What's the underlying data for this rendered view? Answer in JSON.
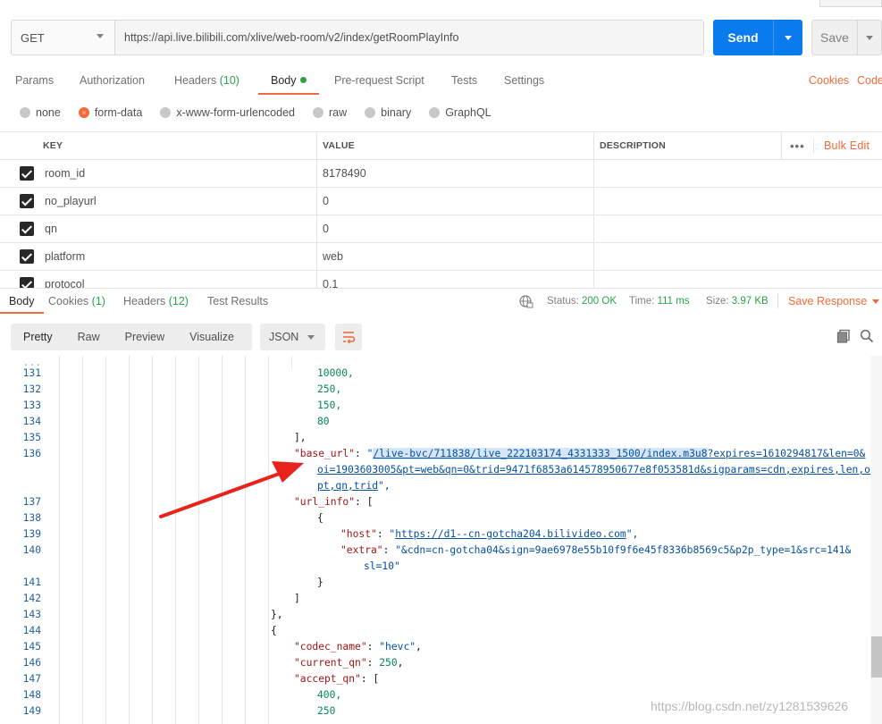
{
  "request": {
    "method": "GET",
    "url": "https://api.live.bilibili.com/xlive/web-room/v2/index/getRoomPlayInfo",
    "send_label": "Send",
    "save_label": "Save"
  },
  "request_tabs": {
    "params": "Params",
    "authorization": "Authorization",
    "headers": "Headers",
    "headers_count": "(10)",
    "body": "Body",
    "prerequest": "Pre-request Script",
    "tests": "Tests",
    "settings": "Settings",
    "cookies": "Cookies",
    "code": "Code"
  },
  "body_types": {
    "none": "none",
    "form_data": "form-data",
    "urlencoded": "x-www-form-urlencoded",
    "raw": "raw",
    "binary": "binary",
    "graphql": "GraphQL"
  },
  "params_table": {
    "col_key": "KEY",
    "col_value": "VALUE",
    "col_description": "DESCRIPTION",
    "more": "•••",
    "bulk_edit": "Bulk Edit",
    "rows": [
      {
        "key": "room_id",
        "value": "8178490"
      },
      {
        "key": "no_playurl",
        "value": "0"
      },
      {
        "key": "qn",
        "value": "0"
      },
      {
        "key": "platform",
        "value": "web"
      },
      {
        "key": "protocol",
        "value": "0,1"
      }
    ]
  },
  "response_tabs": {
    "body": "Body",
    "cookies": "Cookies",
    "cookies_count": "(1)",
    "headers": "Headers",
    "headers_count": "(12)",
    "test_results": "Test Results"
  },
  "response_status": {
    "status_label": "Status:",
    "status_value": "200 OK",
    "time_label": "Time:",
    "time_value": "111 ms",
    "size_label": "Size:",
    "size_value": "3.97 KB",
    "save_response": "Save Response"
  },
  "view_modes": {
    "pretty": "Pretty",
    "raw": "Raw",
    "preview": "Preview",
    "visualize": "Visualize",
    "format": "JSON"
  },
  "code": {
    "line_numbers": [
      "131",
      "132",
      "133",
      "134",
      "135",
      "136",
      "",
      "",
      "137",
      "138",
      "139",
      "140",
      "",
      "141",
      "142",
      "143",
      "144",
      "145",
      "146",
      "147",
      "148",
      "149"
    ],
    "l131": "10000,",
    "l132": "250,",
    "l133": "150,",
    "l134": "80",
    "l135": "],",
    "base_url_key": "\"base_url\"",
    "base_url_path": "/live-bvc/711838/live_222103174_4331333_1500/index.m3u8",
    "base_url_rest1": "?expires=1610294817&len=0&",
    "base_url_rest2": "oi=1903603005&pt=web&qn=0&trid=9471f6853a614578950677e8f053581d&sigparams=cdn,expires,len,oi,",
    "base_url_rest3": "pt,qn,trid",
    "url_info_key": "\"url_info\"",
    "host_key": "\"host\"",
    "host_value": "https://d1--cn-gotcha204.bilivideo.com",
    "extra_key": "\"extra\"",
    "extra_value1": "\"&cdn=cn-gotcha04&sign=9ae6978e55b10f9f6e45f8336b8569c5&p2p_type=1&src=141&",
    "extra_value2": "sl=10\"",
    "codec_key": "\"codec_name\"",
    "codec_value": "\"hevc\"",
    "current_qn_key": "\"current_qn\"",
    "current_qn_value": "250",
    "accept_qn_key": "\"accept_qn\"",
    "l148": "400,",
    "l149": "250"
  },
  "watermark": "https://blog.csdn.net/zy1281539626",
  "colors": {
    "accent": "#f26b3a",
    "send_blue": "#097bed",
    "success_green": "#2aa34a",
    "arrow_red": "#e8231b"
  }
}
